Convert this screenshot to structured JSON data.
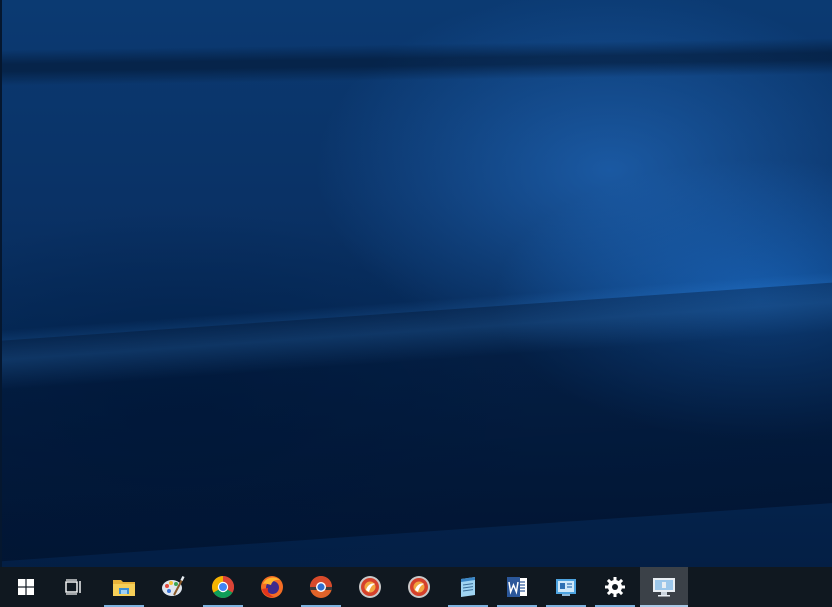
{
  "desktop": {
    "wallpaper": "windows-10-hero-blue"
  },
  "taskbar": {
    "start": {
      "icon": "windows-logo-icon"
    },
    "task_view": {
      "icon": "task-view-icon"
    },
    "apps": [
      {
        "id": "file-explorer",
        "icon": "folder-icon",
        "running": true,
        "active": false
      },
      {
        "id": "paint",
        "icon": "paint-palette-icon",
        "running": false,
        "active": false
      },
      {
        "id": "chrome",
        "icon": "chrome-icon",
        "running": true,
        "active": false
      },
      {
        "id": "firefox",
        "icon": "firefox-icon",
        "running": false,
        "active": false
      },
      {
        "id": "chrome-canary",
        "icon": "chrome-variant-icon",
        "running": true,
        "active": false
      },
      {
        "id": "app-red-1",
        "icon": "red-circle-app-icon",
        "running": false,
        "active": false
      },
      {
        "id": "app-red-2",
        "icon": "red-circle-app-icon",
        "running": false,
        "active": false
      },
      {
        "id": "notepad",
        "icon": "notepad-icon",
        "running": true,
        "active": false
      },
      {
        "id": "word",
        "icon": "word-icon",
        "running": true,
        "active": false
      },
      {
        "id": "control-panel",
        "icon": "control-panel-icon",
        "running": true,
        "active": false
      },
      {
        "id": "settings",
        "icon": "gear-icon",
        "running": true,
        "active": false
      },
      {
        "id": "remote-desktop",
        "icon": "monitor-icon",
        "running": true,
        "active": true
      }
    ]
  }
}
